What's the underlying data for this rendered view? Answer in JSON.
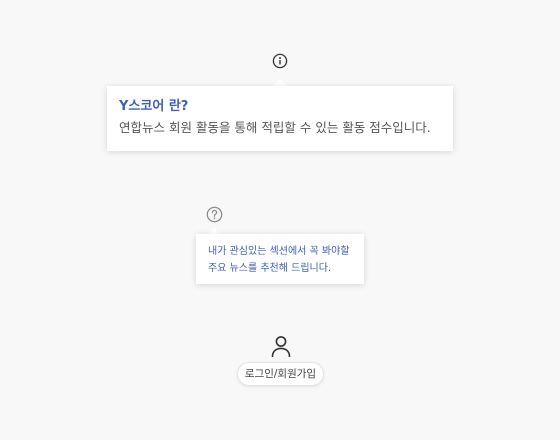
{
  "icons": {
    "info": "info-icon",
    "help": "question-icon",
    "user": "user-icon"
  },
  "yscore_tooltip": {
    "title": "Y스코어 란?",
    "description": "연합뉴스 회원 활동을 통해 적립할 수 있는 활동 점수입니다."
  },
  "recommend_tooltip": {
    "line1": "내가 관심있는 섹션에서 꼭 봐야할",
    "line2": "주요 뉴스를 추천해 드립니다."
  },
  "login": {
    "label": "로그인/회원가입"
  },
  "colors": {
    "background": "#f8f8f8",
    "accent": "#3f5fb6",
    "text": "#555555",
    "icon": "#333333",
    "muted_icon": "#888888"
  }
}
